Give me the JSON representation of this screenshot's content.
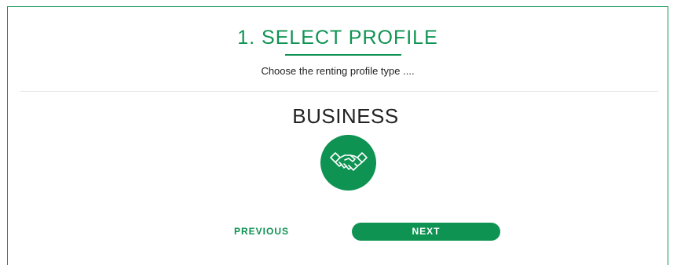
{
  "step": {
    "title": "1. SELECT PROFILE",
    "subtitle": "Choose the renting profile type ...."
  },
  "profile": {
    "label": "BUSINESS",
    "icon": "handshake-icon"
  },
  "navigation": {
    "previous_label": "PREVIOUS",
    "next_label": "NEXT"
  },
  "colors": {
    "accent": "#0e9352",
    "text": "#222222",
    "divider": "#e3e3e3"
  }
}
